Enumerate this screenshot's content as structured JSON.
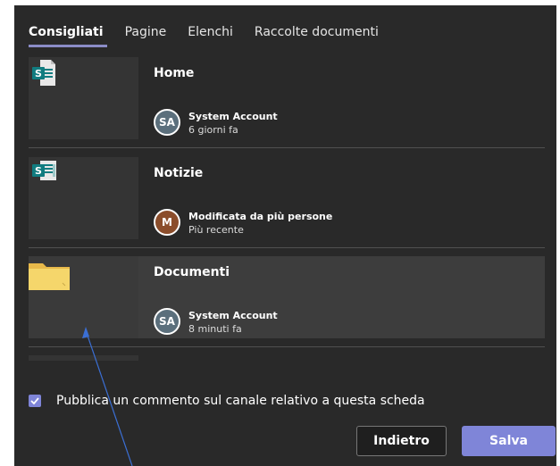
{
  "tabs": [
    "Consigliati",
    "Pagine",
    "Elenchi",
    "Raccolte documenti"
  ],
  "cards": [
    {
      "title": "Home",
      "avatar": "SA",
      "avatar_color": "#5b6f7c",
      "meta": "System Account",
      "sub": "6 giorni fa",
      "icon": "sharepoint-page-icon"
    },
    {
      "title": "Notizie",
      "avatar": "M",
      "avatar_color": "#8b4d2b",
      "meta": "Modificata da più persone",
      "sub": "Più recente",
      "icon": "sharepoint-news-icon"
    },
    {
      "title": "Documenti",
      "avatar": "SA",
      "avatar_color": "#5b6f7c",
      "meta": "System Account",
      "sub": "8 minuti fa",
      "icon": "folder-icon"
    }
  ],
  "checkbox_label": "Pubblica un commento sul canale relativo a questa scheda",
  "checkbox_checked": true,
  "buttons": {
    "back": "Indietro",
    "save": "Salva"
  },
  "colors": {
    "accent": "#7f85d8",
    "background": "#292929",
    "sharepoint_teal": "#117c80",
    "folder_yellow": "#f5d66b"
  }
}
